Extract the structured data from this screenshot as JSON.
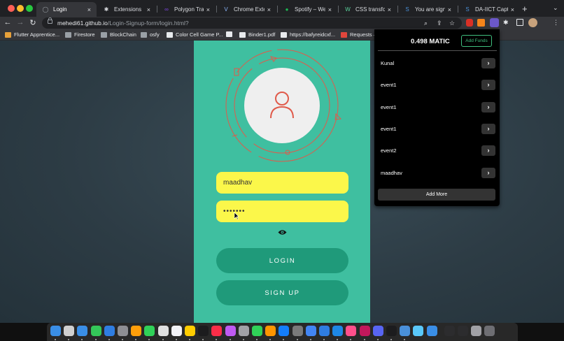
{
  "browser": {
    "tabs": [
      {
        "label": "Login",
        "close": "×",
        "fav": "#9aa0a6",
        "glyph": "◯",
        "active": true
      },
      {
        "label": "Extensions",
        "close": "×",
        "fav": "#dadce0",
        "glyph": "✱"
      },
      {
        "label": "Polygon Transac",
        "close": "×",
        "fav": "#8247e5",
        "glyph": "∞"
      },
      {
        "label": "Chrome Extensi",
        "close": "×",
        "fav": "#8ab4f8",
        "glyph": "V"
      },
      {
        "label": "Spotify – Web P",
        "close": "×",
        "fav": "#1db954",
        "glyph": "●"
      },
      {
        "label": "CSS transform",
        "close": "×",
        "fav": "#5ad19b",
        "glyph": "W"
      },
      {
        "label": "You are signed",
        "close": "×",
        "fav": "#4a90d9",
        "glyph": "S"
      },
      {
        "label": "DA-IICT Captive",
        "close": "×",
        "fav": "#4a90d9",
        "glyph": "S"
      }
    ],
    "new_tab": "+",
    "tab_menu": "⌄",
    "url_host": "mehedi61.github.io",
    "url_path": "/Login-Signup-form/login.html?",
    "bookmarks": [
      {
        "label": "Flutter Apprentice...",
        "color": "#e8a13a"
      },
      {
        "label": "Firestore",
        "color": "#9aa0a6"
      },
      {
        "label": "BlockChain",
        "color": "#9aa0a6"
      },
      {
        "label": "osfy",
        "color": "#9aa0a6"
      },
      {
        "label": "Color Cell Game P...",
        "color": "#e8eaed"
      },
      {
        "label": "",
        "color": "#e8eaed"
      },
      {
        "label": "Binder1.pdf",
        "color": "#e8eaed"
      },
      {
        "label": "https://bafyreidcxf...",
        "color": "#e8eaed"
      },
      {
        "label": "Requests –",
        "color": "#e0463c"
      }
    ]
  },
  "login": {
    "username_value": "maadhav",
    "password_value": "•••••••",
    "login_label": "LOGIN",
    "signup_label": "SIGN UP"
  },
  "wallet": {
    "balance": "0.498 MATIC",
    "add_funds": "Add Funds",
    "items": [
      "Kunal",
      "event1",
      "event1",
      "event1",
      "event2",
      "maadhav"
    ],
    "chevron": "›",
    "add_more": "Add More"
  },
  "colors": {
    "card": "#3fbfa0",
    "field": "#fbf74a",
    "button": "#1f9a7a",
    "accent_red": "#e05a4a",
    "wallet_green": "#3fbf7f"
  },
  "dock": [
    "#3a8ee6",
    "#d0d0d0",
    "#3a8ee6",
    "#34c759",
    "#2f7de1",
    "#8e8e93",
    "#ff9f0a",
    "#30d158",
    "#e0e0e0",
    "#f2f2f7",
    "#ffcc00",
    "#1c1c1e",
    "#fa2d48",
    "#bf5af2",
    "#a1a1a6",
    "#30d158",
    "#ff9500",
    "#147efb",
    "#7a7a7a",
    "#4285f4",
    "#2f7de1",
    "#1e88e5",
    "#ff4f8b",
    "#c2185b",
    "#5865f2",
    "#1c1c1e",
    "#4a90d9",
    "#5ac8fa",
    "#3a8ee6",
    "#2c2c2e",
    "#2c2c2e",
    "#a1a1a6",
    "#6e6e73"
  ]
}
